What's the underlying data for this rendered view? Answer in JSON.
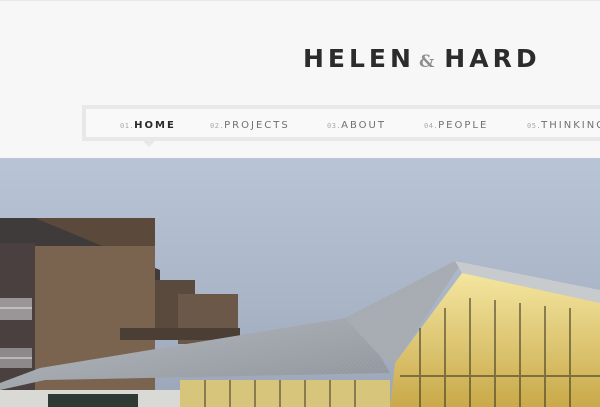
{
  "brand": {
    "name_left": "HELEN",
    "ampersand": "&",
    "name_right": "HARD"
  },
  "nav": {
    "items": [
      {
        "num": "01.",
        "label": "HOME",
        "active": true
      },
      {
        "num": "02.",
        "label": "PROJECTS",
        "active": false
      },
      {
        "num": "03.",
        "label": "ABOUT",
        "active": false
      },
      {
        "num": "04.",
        "label": "PEOPLE",
        "active": false
      },
      {
        "num": "05.",
        "label": "THINKING",
        "active": false
      }
    ]
  },
  "colors": {
    "page_bg": "#f7f7f7",
    "logo_text": "#2c2c2c",
    "ampersand": "#8f8f8f",
    "nav_border": "#e8e8e8",
    "nav_active": "#2a2a2a",
    "nav_inactive": "#707070"
  }
}
